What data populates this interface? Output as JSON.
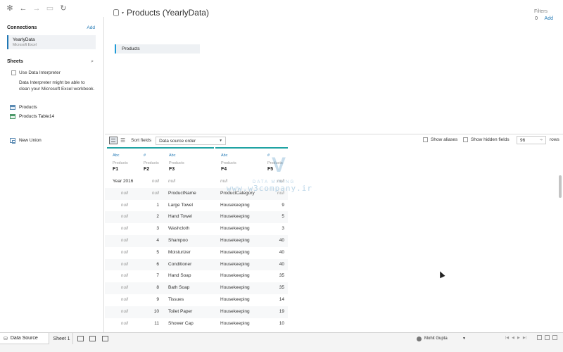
{
  "toolbar": {
    "icons": [
      "tableau-logo-icon",
      "back-arrow-icon",
      "forward-arrow-icon",
      "save-icon",
      "refresh-icon"
    ]
  },
  "connections": {
    "heading": "Connections",
    "add_label": "Add",
    "items": [
      {
        "name": "YearlyData",
        "type": "Microsoft Excel"
      }
    ]
  },
  "sheets": {
    "heading": "Sheets",
    "interpreter_label": "Use Data Interpreter",
    "interpreter_checked": false,
    "interpreter_desc": "Data Interpreter might be able to clean your Microsoft Excel workbook.",
    "items": [
      {
        "label": "Products",
        "icon": "sheet-icon"
      },
      {
        "label": "Products Table14",
        "icon": "named-range-icon"
      }
    ],
    "new_union": "New Union"
  },
  "canvas": {
    "title": "Products (YearlyData)",
    "filters_label": "Filters",
    "filters_count": "0",
    "filters_add": "Add",
    "table_pill": "Products"
  },
  "grid_toolbar": {
    "sort_label": "Sort fields",
    "sort_value": "Data source order",
    "show_aliases": "Show aliases",
    "show_hidden": "Show hidden fields",
    "rows_value": "96",
    "rows_label": "rows"
  },
  "columns": [
    {
      "type": "Abc",
      "source": "Products",
      "field": "F1"
    },
    {
      "type": "#",
      "source": "Products",
      "field": "F2"
    },
    {
      "type": "Abc",
      "source": "Products",
      "field": "F3"
    },
    {
      "type": "Abc",
      "source": "Products",
      "field": "F4"
    },
    {
      "type": "#",
      "source": "Products",
      "field": "F5"
    }
  ],
  "rows": [
    [
      "Year 2016",
      "null",
      "null",
      "null",
      "null"
    ],
    [
      "null",
      "null",
      "ProductName",
      "ProductCategory",
      "null"
    ],
    [
      "null",
      "1",
      "Large Towel",
      "Housekeeping",
      "9"
    ],
    [
      "null",
      "2",
      "Hand Towel",
      "Housekeeping",
      "5"
    ],
    [
      "null",
      "3",
      "Washcloth",
      "Housekeeping",
      "3"
    ],
    [
      "null",
      "4",
      "Shampoo",
      "Housekeeping",
      "40"
    ],
    [
      "null",
      "5",
      "Moisturizer",
      "Housekeeping",
      "40"
    ],
    [
      "null",
      "6",
      "Conditioner",
      "Housekeeping",
      "40"
    ],
    [
      "null",
      "7",
      "Hand Soap",
      "Housekeeping",
      "35"
    ],
    [
      "null",
      "8",
      "Bath Soap",
      "Housekeeping",
      "35"
    ],
    [
      "null",
      "9",
      "Tissues",
      "Housekeeping",
      "14"
    ],
    [
      "null",
      "10",
      "Toilet Paper",
      "Housekeeping",
      "19"
    ],
    [
      "null",
      "11",
      "Shower Cap",
      "Housekeeping",
      "10"
    ]
  ],
  "watermark": {
    "logo": "V",
    "text": "DATA MINING",
    "url": "www.w3company.ir"
  },
  "bottom_bar": {
    "data_source_tab": "Data Source",
    "sheet_tab": "Sheet 1",
    "user_name": "Mohit Gupta"
  },
  "colors": {
    "accent": "#1f77b4",
    "header_border": "#1fa3a3"
  }
}
